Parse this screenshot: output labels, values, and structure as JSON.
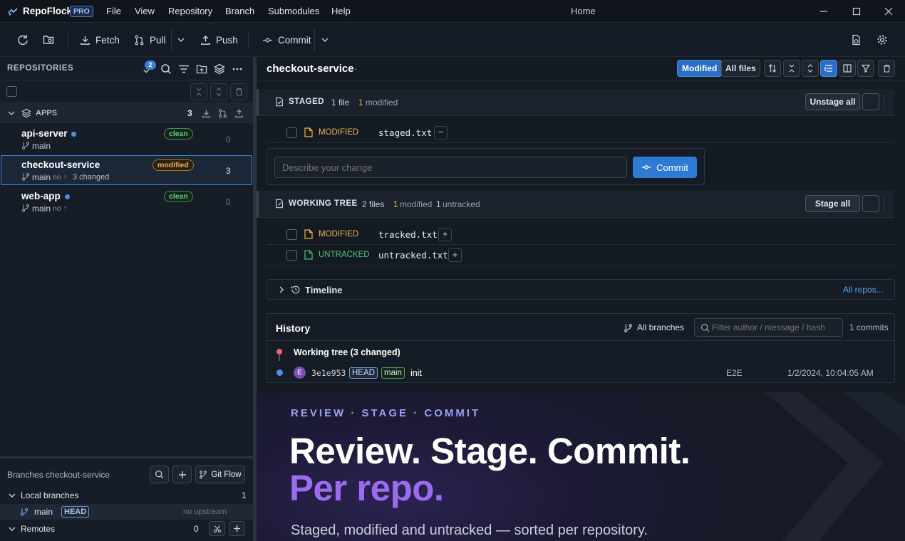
{
  "app": {
    "name": "RepoFlock",
    "tier": "PRO",
    "window_title": "Home"
  },
  "menu": [
    "File",
    "View",
    "Repository",
    "Branch",
    "Submodules",
    "Help"
  ],
  "toolbar": {
    "fetch": "Fetch",
    "pull": "Pull",
    "push": "Push",
    "commit": "Commit"
  },
  "sidebar": {
    "title": "REPOSITORIES",
    "notif_count": "2",
    "group": {
      "name": "APPS",
      "count": "3"
    },
    "repos": [
      {
        "name": "api-server",
        "status": "clean",
        "branch": "main",
        "extra": "",
        "changed": "",
        "count": "0"
      },
      {
        "name": "checkout-service",
        "status": "modified",
        "branch": "main",
        "extra": "no ↑",
        "changed": "3 changed",
        "count": "3"
      },
      {
        "name": "web-app",
        "status": "clean",
        "branch": "main",
        "extra": "no ↑",
        "changed": "",
        "count": "0"
      }
    ],
    "branches": {
      "title": "Branches checkout-service",
      "gitflow": "Git Flow",
      "local_label": "Local branches",
      "local_count": "1",
      "branch": {
        "name": "main",
        "tag": "HEAD",
        "upstream": "no upstream"
      },
      "remotes_label": "Remotes",
      "remotes_count": "0"
    }
  },
  "main": {
    "repo_title": "checkout-service",
    "repo_dot": "·",
    "filters": {
      "modified": "Modified",
      "all": "All files"
    },
    "staged": {
      "label": "STAGED",
      "files": "1 file",
      "mod_count": "1",
      "mod_label": "modified",
      "action": "Unstage all",
      "rows": [
        {
          "status": "MODIFIED",
          "file": "staged.txt",
          "sign": "−"
        }
      ]
    },
    "commit_box": {
      "placeholder": "Describe your change",
      "button": "Commit"
    },
    "working": {
      "label": "WORKING TREE",
      "files": "2 files",
      "mod_count": "1",
      "mod_label": "modified",
      "untr_count": "1",
      "untr_label": "untracked",
      "action": "Stage all",
      "rows": [
        {
          "status": "MODIFIED",
          "file": "tracked.txt",
          "sign": "+"
        },
        {
          "status": "UNTRACKED",
          "file": "untracked.txt",
          "sign": "+"
        }
      ]
    },
    "timeline": {
      "label": "Timeline",
      "link": "All repos..."
    },
    "history": {
      "title": "History",
      "branches": "All branches",
      "search_placeholder": "Filter author / message / hash",
      "commits_count": "1 commits",
      "working_tree": "Working tree (3 changed)",
      "commit": {
        "avatar": "E",
        "hash": "3e1e953",
        "tags": [
          "HEAD",
          "main"
        ],
        "message": "init",
        "author": "E2E",
        "date": "1/2/2024, 10:04:05 AM"
      }
    },
    "promo": {
      "kicker": "REVIEW · STAGE · COMMIT",
      "headline1": "Review. Stage. Commit.",
      "headline2": "Per repo.",
      "subline": "Staged, modified and untracked — sorted per repository."
    }
  },
  "colors": {
    "accent": "#3b82d6",
    "modified": "#f0b44c",
    "untracked": "#4fc27a",
    "clean": "#5fd07f",
    "promo_purple": "#9b6cf0"
  }
}
